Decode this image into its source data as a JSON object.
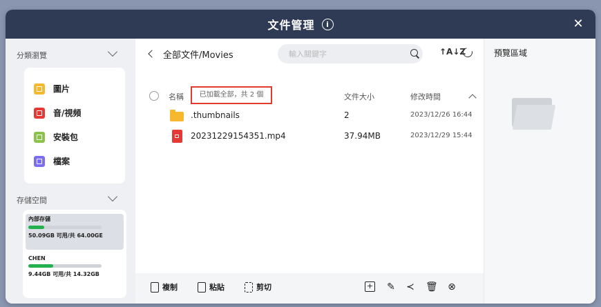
{
  "window": {
    "title": "文件管理",
    "info_symbol": "i",
    "close_symbol": "✕"
  },
  "sidebar": {
    "browse_title": "分類瀏覽",
    "categories": [
      {
        "label": "圖片",
        "icon": "image-icon",
        "color": "#f5b82e"
      },
      {
        "label": "音/視頻",
        "icon": "media-icon",
        "color": "#e53935"
      },
      {
        "label": "安裝包",
        "icon": "package-icon",
        "color": "#8bc34a"
      },
      {
        "label": "檔案",
        "icon": "document-icon",
        "color": "#7c6cf0"
      }
    ],
    "storage_title": "存儲空間",
    "storage": [
      {
        "name": "內部存儲",
        "info": "50.09GB 可用/共 64.00GE",
        "used_fraction": 0.22
      },
      {
        "name": "CHEN",
        "info": "9.44GB 可用/共 14.32GB",
        "used_fraction": 0.34
      }
    ]
  },
  "main": {
    "path": "全部文件/Movies",
    "search_placeholder": "輸入關鍵字",
    "sort_symbol": "↑A↓Z",
    "columns": {
      "name": "名稱",
      "size": "文件大小",
      "modified": "修改時間"
    },
    "loaded_notice": "已加載全部，共 2 個",
    "files": [
      {
        "name": ".thumbnails",
        "size": "2",
        "modified": "2023/12/26 16:44",
        "icon": "folder-icon"
      },
      {
        "name": "20231229154351.mp4",
        "size": "37.94MB",
        "modified": "2023/12/29 15:44",
        "icon": "video-file-icon"
      }
    ],
    "toolbar": {
      "copy": "複制",
      "paste": "粘貼",
      "cut": "剪切"
    }
  },
  "preview": {
    "title": "預覽區域"
  },
  "colors": {
    "titlebar": "#2f3a55",
    "accent_red": "#e03a2f",
    "storage_green": "#22b14c"
  }
}
